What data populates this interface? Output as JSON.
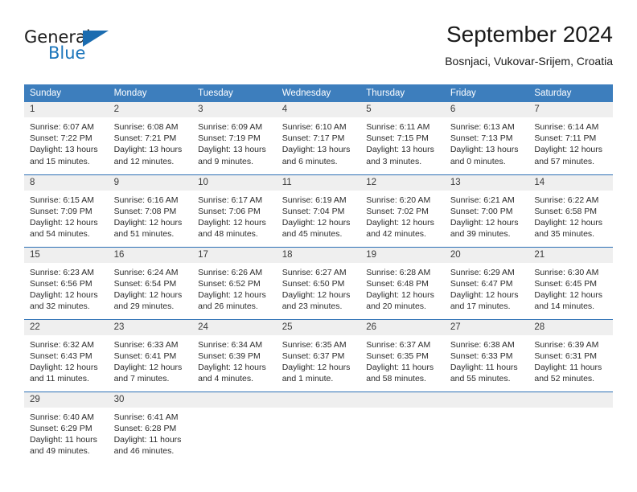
{
  "brand": {
    "name_part1": "General",
    "name_part2": "Blue",
    "logo_icon": "triangle-logo-icon"
  },
  "header": {
    "month_title": "September 2024",
    "location": "Bosnjaci, Vukovar-Srijem, Croatia",
    "accent_color": "#3d7ebd",
    "brand_blue": "#1b75bb"
  },
  "weekdays": [
    "Sunday",
    "Monday",
    "Tuesday",
    "Wednesday",
    "Thursday",
    "Friday",
    "Saturday"
  ],
  "weeks": [
    [
      {
        "day": "1",
        "sunrise": "Sunrise: 6:07 AM",
        "sunset": "Sunset: 7:22 PM",
        "daylight_line1": "Daylight: 13 hours",
        "daylight_line2": "and 15 minutes."
      },
      {
        "day": "2",
        "sunrise": "Sunrise: 6:08 AM",
        "sunset": "Sunset: 7:21 PM",
        "daylight_line1": "Daylight: 13 hours",
        "daylight_line2": "and 12 minutes."
      },
      {
        "day": "3",
        "sunrise": "Sunrise: 6:09 AM",
        "sunset": "Sunset: 7:19 PM",
        "daylight_line1": "Daylight: 13 hours",
        "daylight_line2": "and 9 minutes."
      },
      {
        "day": "4",
        "sunrise": "Sunrise: 6:10 AM",
        "sunset": "Sunset: 7:17 PM",
        "daylight_line1": "Daylight: 13 hours",
        "daylight_line2": "and 6 minutes."
      },
      {
        "day": "5",
        "sunrise": "Sunrise: 6:11 AM",
        "sunset": "Sunset: 7:15 PM",
        "daylight_line1": "Daylight: 13 hours",
        "daylight_line2": "and 3 minutes."
      },
      {
        "day": "6",
        "sunrise": "Sunrise: 6:13 AM",
        "sunset": "Sunset: 7:13 PM",
        "daylight_line1": "Daylight: 13 hours",
        "daylight_line2": "and 0 minutes."
      },
      {
        "day": "7",
        "sunrise": "Sunrise: 6:14 AM",
        "sunset": "Sunset: 7:11 PM",
        "daylight_line1": "Daylight: 12 hours",
        "daylight_line2": "and 57 minutes."
      }
    ],
    [
      {
        "day": "8",
        "sunrise": "Sunrise: 6:15 AM",
        "sunset": "Sunset: 7:09 PM",
        "daylight_line1": "Daylight: 12 hours",
        "daylight_line2": "and 54 minutes."
      },
      {
        "day": "9",
        "sunrise": "Sunrise: 6:16 AM",
        "sunset": "Sunset: 7:08 PM",
        "daylight_line1": "Daylight: 12 hours",
        "daylight_line2": "and 51 minutes."
      },
      {
        "day": "10",
        "sunrise": "Sunrise: 6:17 AM",
        "sunset": "Sunset: 7:06 PM",
        "daylight_line1": "Daylight: 12 hours",
        "daylight_line2": "and 48 minutes."
      },
      {
        "day": "11",
        "sunrise": "Sunrise: 6:19 AM",
        "sunset": "Sunset: 7:04 PM",
        "daylight_line1": "Daylight: 12 hours",
        "daylight_line2": "and 45 minutes."
      },
      {
        "day": "12",
        "sunrise": "Sunrise: 6:20 AM",
        "sunset": "Sunset: 7:02 PM",
        "daylight_line1": "Daylight: 12 hours",
        "daylight_line2": "and 42 minutes."
      },
      {
        "day": "13",
        "sunrise": "Sunrise: 6:21 AM",
        "sunset": "Sunset: 7:00 PM",
        "daylight_line1": "Daylight: 12 hours",
        "daylight_line2": "and 39 minutes."
      },
      {
        "day": "14",
        "sunrise": "Sunrise: 6:22 AM",
        "sunset": "Sunset: 6:58 PM",
        "daylight_line1": "Daylight: 12 hours",
        "daylight_line2": "and 35 minutes."
      }
    ],
    [
      {
        "day": "15",
        "sunrise": "Sunrise: 6:23 AM",
        "sunset": "Sunset: 6:56 PM",
        "daylight_line1": "Daylight: 12 hours",
        "daylight_line2": "and 32 minutes."
      },
      {
        "day": "16",
        "sunrise": "Sunrise: 6:24 AM",
        "sunset": "Sunset: 6:54 PM",
        "daylight_line1": "Daylight: 12 hours",
        "daylight_line2": "and 29 minutes."
      },
      {
        "day": "17",
        "sunrise": "Sunrise: 6:26 AM",
        "sunset": "Sunset: 6:52 PM",
        "daylight_line1": "Daylight: 12 hours",
        "daylight_line2": "and 26 minutes."
      },
      {
        "day": "18",
        "sunrise": "Sunrise: 6:27 AM",
        "sunset": "Sunset: 6:50 PM",
        "daylight_line1": "Daylight: 12 hours",
        "daylight_line2": "and 23 minutes."
      },
      {
        "day": "19",
        "sunrise": "Sunrise: 6:28 AM",
        "sunset": "Sunset: 6:48 PM",
        "daylight_line1": "Daylight: 12 hours",
        "daylight_line2": "and 20 minutes."
      },
      {
        "day": "20",
        "sunrise": "Sunrise: 6:29 AM",
        "sunset": "Sunset: 6:47 PM",
        "daylight_line1": "Daylight: 12 hours",
        "daylight_line2": "and 17 minutes."
      },
      {
        "day": "21",
        "sunrise": "Sunrise: 6:30 AM",
        "sunset": "Sunset: 6:45 PM",
        "daylight_line1": "Daylight: 12 hours",
        "daylight_line2": "and 14 minutes."
      }
    ],
    [
      {
        "day": "22",
        "sunrise": "Sunrise: 6:32 AM",
        "sunset": "Sunset: 6:43 PM",
        "daylight_line1": "Daylight: 12 hours",
        "daylight_line2": "and 11 minutes."
      },
      {
        "day": "23",
        "sunrise": "Sunrise: 6:33 AM",
        "sunset": "Sunset: 6:41 PM",
        "daylight_line1": "Daylight: 12 hours",
        "daylight_line2": "and 7 minutes."
      },
      {
        "day": "24",
        "sunrise": "Sunrise: 6:34 AM",
        "sunset": "Sunset: 6:39 PM",
        "daylight_line1": "Daylight: 12 hours",
        "daylight_line2": "and 4 minutes."
      },
      {
        "day": "25",
        "sunrise": "Sunrise: 6:35 AM",
        "sunset": "Sunset: 6:37 PM",
        "daylight_line1": "Daylight: 12 hours",
        "daylight_line2": "and 1 minute."
      },
      {
        "day": "26",
        "sunrise": "Sunrise: 6:37 AM",
        "sunset": "Sunset: 6:35 PM",
        "daylight_line1": "Daylight: 11 hours",
        "daylight_line2": "and 58 minutes."
      },
      {
        "day": "27",
        "sunrise": "Sunrise: 6:38 AM",
        "sunset": "Sunset: 6:33 PM",
        "daylight_line1": "Daylight: 11 hours",
        "daylight_line2": "and 55 minutes."
      },
      {
        "day": "28",
        "sunrise": "Sunrise: 6:39 AM",
        "sunset": "Sunset: 6:31 PM",
        "daylight_line1": "Daylight: 11 hours",
        "daylight_line2": "and 52 minutes."
      }
    ],
    [
      {
        "day": "29",
        "sunrise": "Sunrise: 6:40 AM",
        "sunset": "Sunset: 6:29 PM",
        "daylight_line1": "Daylight: 11 hours",
        "daylight_line2": "and 49 minutes."
      },
      {
        "day": "30",
        "sunrise": "Sunrise: 6:41 AM",
        "sunset": "Sunset: 6:28 PM",
        "daylight_line1": "Daylight: 11 hours",
        "daylight_line2": "and 46 minutes."
      },
      {
        "day": "",
        "sunrise": "",
        "sunset": "",
        "daylight_line1": "",
        "daylight_line2": ""
      },
      {
        "day": "",
        "sunrise": "",
        "sunset": "",
        "daylight_line1": "",
        "daylight_line2": ""
      },
      {
        "day": "",
        "sunrise": "",
        "sunset": "",
        "daylight_line1": "",
        "daylight_line2": ""
      },
      {
        "day": "",
        "sunrise": "",
        "sunset": "",
        "daylight_line1": "",
        "daylight_line2": ""
      },
      {
        "day": "",
        "sunrise": "",
        "sunset": "",
        "daylight_line1": "",
        "daylight_line2": ""
      }
    ]
  ]
}
